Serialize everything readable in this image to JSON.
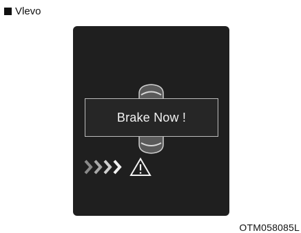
{
  "header": {
    "label": "Vlevo",
    "bullet_icon": "black-square-bullet-icon"
  },
  "display": {
    "message": "Brake Now !",
    "icons": [
      "car-top-view-icon",
      "approach-chevrons-icon",
      "warning-triangle-icon"
    ],
    "background_color": "#1f1f1f",
    "text_color": "#f2f2f2"
  },
  "figure": {
    "code": "OTM058085L"
  }
}
